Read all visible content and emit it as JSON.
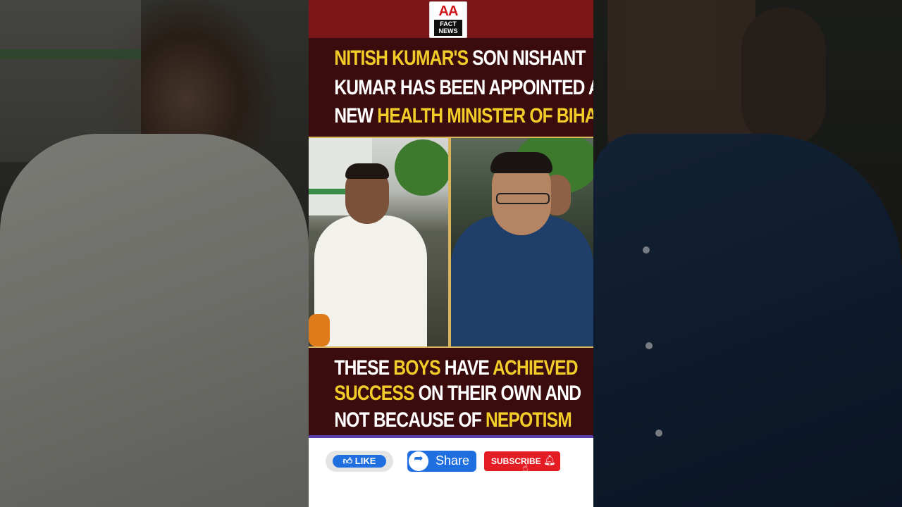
{
  "logo": {
    "line1": "AA",
    "line2": "FACT",
    "line3": "NEWS"
  },
  "headline": {
    "line1": {
      "highlight": "NITISH KUMAR'S",
      "rest": " SON NISHANT"
    },
    "line2": "KUMAR HAS BEEN APPOINTED AS",
    "line3": {
      "lead": "NEW ",
      "highlight": "HEALTH MINISTER OF BIHAR"
    }
  },
  "bottom_caption": {
    "line1": {
      "a": "THESE ",
      "b": "BOYS",
      "c": " HAVE ",
      "d": "ACHIEVED"
    },
    "line2": {
      "a": "SUCCESS",
      "b": " ON THEIR OWN AND"
    },
    "line3": {
      "a": "NOT BECAUSE OF ",
      "b": "NEPOTISM"
    }
  },
  "buttons": {
    "like_label": "LIKE",
    "share_label": "Share",
    "subscribe_label": "SUBSCRIBE"
  },
  "colors": {
    "accent_yellow": "#f2cd29",
    "banner_red": "#7b1619",
    "panel_dark_red": "#3a0c0e",
    "button_blue": "#1f6fe0",
    "subscribe_red": "#e41d24"
  },
  "icons": [
    "thumbs-up-icon",
    "share-arrow-icon",
    "bell-icon",
    "hand-cursor-icon"
  ]
}
